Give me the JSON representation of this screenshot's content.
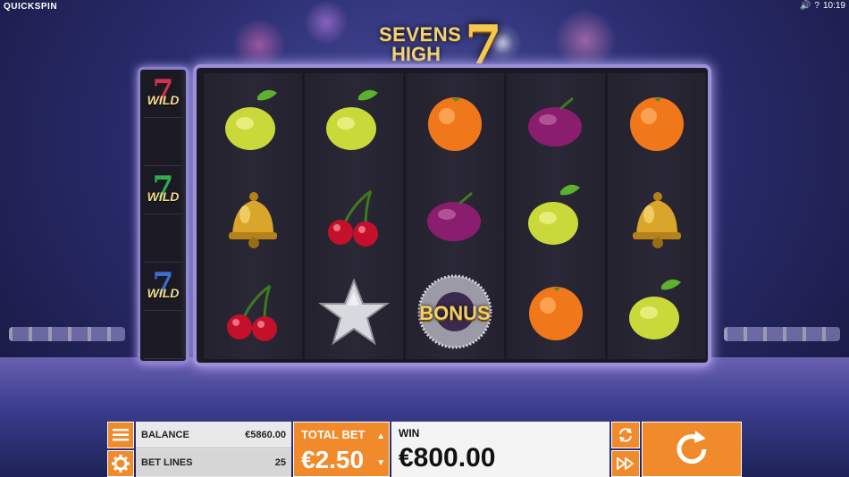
{
  "brand": "QUICKSPIN",
  "status": {
    "time": "10:19",
    "help": "?"
  },
  "logo": {
    "line1": "SEVENS",
    "line2": "HIGH",
    "seven": "7"
  },
  "side_reel": [
    {
      "label": "WILD",
      "seven_color": "#d2324a"
    },
    {
      "label": "",
      "seven_color": ""
    },
    {
      "label": "WILD",
      "seven_color": "#2fae4b"
    },
    {
      "label": "",
      "seven_color": ""
    },
    {
      "label": "WILD",
      "seven_color": "#3d6fd1"
    },
    {
      "label": "",
      "seven_color": ""
    }
  ],
  "reels": [
    [
      "lemon",
      "bell",
      "cherries"
    ],
    [
      "lemon",
      "cherries",
      "star"
    ],
    [
      "orange",
      "plum",
      "bonus"
    ],
    [
      "plum",
      "lemon",
      "orange"
    ],
    [
      "orange",
      "bell",
      "lemon"
    ]
  ],
  "bonus_label": "BONUS",
  "hud": {
    "balance_label": "BALANCE",
    "balance_value": "€5860.00",
    "betlines_label": "BET LINES",
    "betlines_value": "25",
    "totalbet_label": "TOTAL BET",
    "totalbet_value": "€2.50",
    "win_label": "WIN",
    "win_value": "€800.00"
  },
  "colors": {
    "accent": "#f18a2a",
    "frame": "#9a8fd8"
  }
}
